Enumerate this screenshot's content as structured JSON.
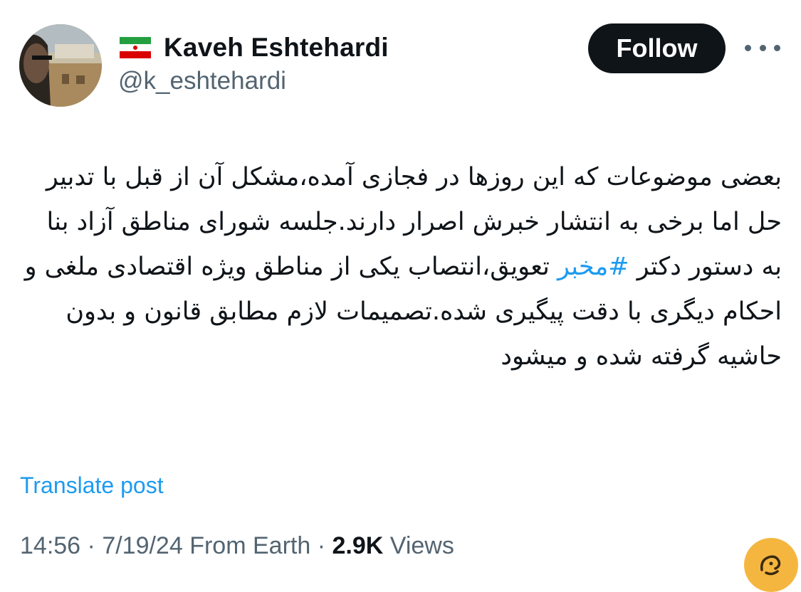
{
  "author": {
    "display_name": "Kaveh Eshtehardi",
    "handle": "@k_eshtehardi",
    "flag_icon": "iran-flag-icon"
  },
  "actions": {
    "follow_label": "Follow",
    "more_icon": "more-horizontal-icon"
  },
  "post": {
    "text_before_hashtag": "بعضی موضوعات که این روزها در فجازی آمده،مشکل آن از قبل با تدبیر حل اما برخی به انتشار خبرش اصرار دارند.جلسه شورای مناطق آزاد بنا به دستور دکتر ",
    "hashtag": "#مخبر",
    "text_after_hashtag": " تعویق،انتصاب یکی از مناطق ویژه اقتصادی ملغی و احکام دیگری با دقت پیگیری شده.تصمیمات لازم مطابق قانون و بدون حاشیه گرفته شده و میشود",
    "translate_label": "Translate post"
  },
  "meta": {
    "time": "14:56",
    "sep1": " · ",
    "date": "7/19/24",
    "sep2": " ",
    "source": "From Earth",
    "sep3": " · ",
    "views_count": "2.9K",
    "views_label": " Views"
  },
  "colors": {
    "text": "#0f1419",
    "secondary": "#536471",
    "link": "#1d9bf0",
    "button_bg": "#0f1419",
    "watermark": "#f5b640"
  }
}
